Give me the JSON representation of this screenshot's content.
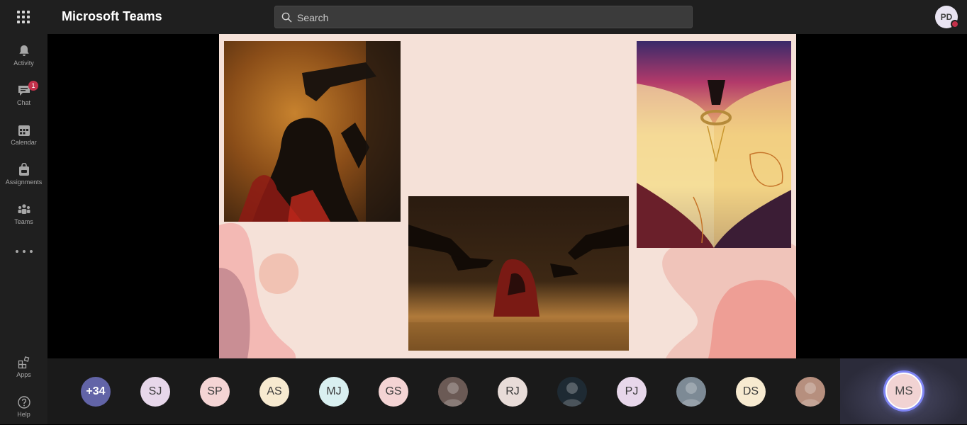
{
  "app": {
    "title": "Microsoft Teams"
  },
  "search": {
    "placeholder": "Search"
  },
  "user": {
    "initials": "PD",
    "status_color": "#c4314b"
  },
  "rail": {
    "items": [
      {
        "label": "Activity",
        "icon": "bell-icon"
      },
      {
        "label": "Chat",
        "icon": "chat-icon",
        "badge": "1"
      },
      {
        "label": "Calendar",
        "icon": "calendar-icon"
      },
      {
        "label": "Assignments",
        "icon": "assignments-icon"
      },
      {
        "label": "Teams",
        "icon": "teams-icon"
      },
      {
        "label": "Apps",
        "icon": "apps-icon"
      },
      {
        "label": "Help",
        "icon": "help-icon"
      }
    ]
  },
  "participants": [
    {
      "initials": "+34",
      "bg": "#6264a7",
      "fg": "#ffffff"
    },
    {
      "initials": "SJ",
      "bg": "#e7d7ea"
    },
    {
      "initials": "SP",
      "bg": "#f4d4d4"
    },
    {
      "initials": "AS",
      "bg": "#f7ead0"
    },
    {
      "initials": "MJ",
      "bg": "#d9f0f1"
    },
    {
      "initials": "GS",
      "bg": "#f4d4d4"
    },
    {
      "initials": "",
      "bg": "#6b5a55",
      "photo": true
    },
    {
      "initials": "RJ",
      "bg": "#e8dcd8"
    },
    {
      "initials": "",
      "bg": "#1e2a33",
      "photo": true
    },
    {
      "initials": "PJ",
      "bg": "#e7d7ea"
    },
    {
      "initials": "",
      "bg": "#7d8a95",
      "photo": true
    },
    {
      "initials": "DS",
      "bg": "#f7ead0"
    },
    {
      "initials": "",
      "bg": "#b68f7e",
      "photo": true
    }
  ],
  "self": {
    "initials": "MS"
  },
  "colors": {
    "accent": "#7f85f5",
    "topbar": "#1f1f1f",
    "slide_bg": "#f5e1d8"
  }
}
